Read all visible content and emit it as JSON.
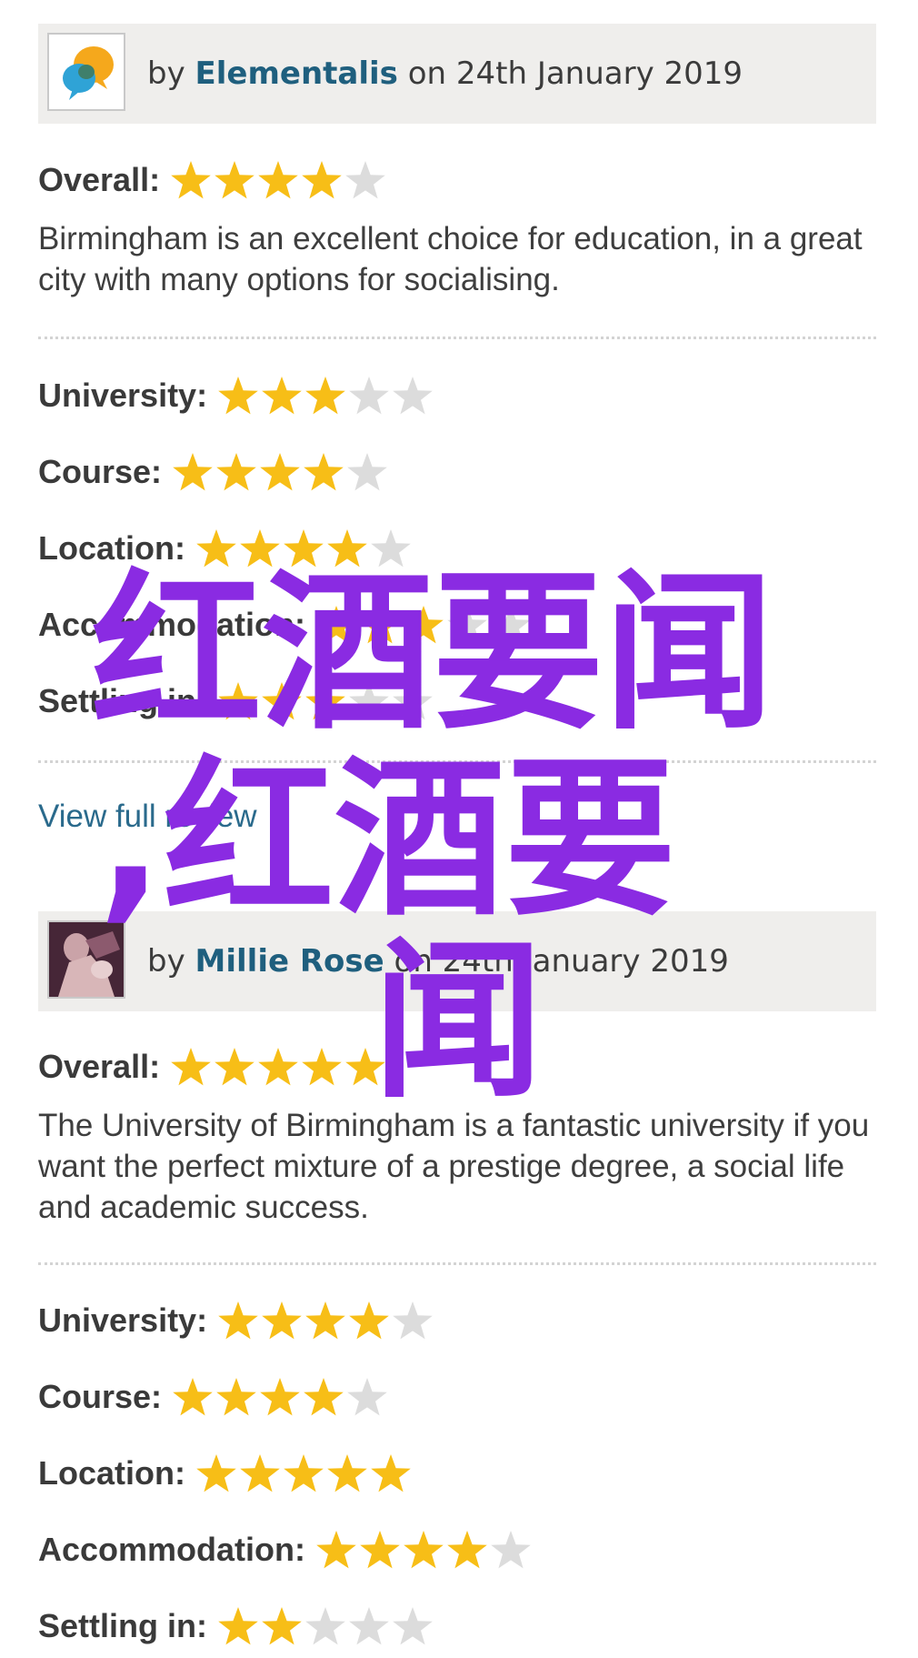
{
  "reviews": [
    {
      "by": "by",
      "author": "Elementalis",
      "date_text": "on 24th January 2019",
      "overall_label": "Overall:",
      "overall_stars": 4,
      "text": "Birmingham is an excellent choice for education, in a great city with many options for socialising.",
      "ratings": [
        {
          "label": "University:",
          "stars": 3
        },
        {
          "label": "Course:",
          "stars": 4
        },
        {
          "label": "Location:",
          "stars": 4
        },
        {
          "label": "Accommodation:",
          "stars": 3
        },
        {
          "label": "Settling in:",
          "stars": 3
        }
      ],
      "view_link": "View full review"
    },
    {
      "by": "by",
      "author": "Millie Rose",
      "date_text": "on 24th January 2019",
      "overall_label": "Overall:",
      "overall_stars": 5,
      "text": "The University of Birmingham is a fantastic university if you want the perfect mixture of a prestige degree, a social life and academic success.",
      "ratings": [
        {
          "label": "University:",
          "stars": 4
        },
        {
          "label": "Course:",
          "stars": 4
        },
        {
          "label": "Location:",
          "stars": 5
        },
        {
          "label": "Accommodation:",
          "stars": 4
        },
        {
          "label": "Settling in:",
          "stars": 2
        }
      ]
    }
  ],
  "max_stars": 5,
  "colors": {
    "star_filled": "#f7be17",
    "star_empty": "#dcdcdc",
    "author_link": "#1f5f7e",
    "overlay": "#8a2be2"
  },
  "overlay": {
    "line1": "红酒要闻",
    "line2": ",红酒要",
    "line3": "闻"
  }
}
